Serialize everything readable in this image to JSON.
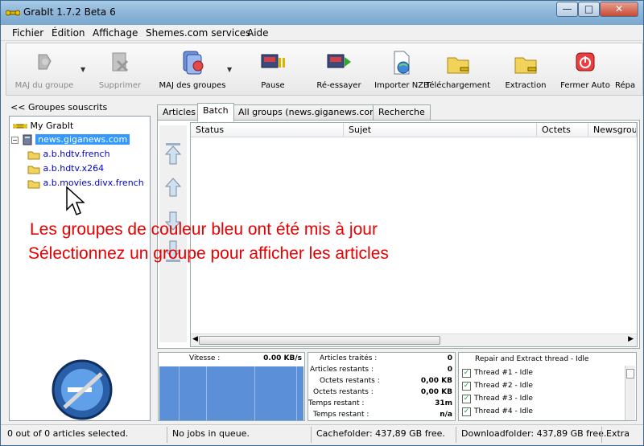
{
  "window": {
    "title": "GrabIt 1.7.2 Beta 6",
    "min": "—",
    "max": "□",
    "close": "✕"
  },
  "menu": [
    "Fichier",
    "Édition",
    "Affichage",
    "Shemes.com services",
    "Aide"
  ],
  "toolbar": [
    {
      "label": "MAJ du groupe",
      "icon": "update-group-icon",
      "enabled": false
    },
    {
      "label": "Supprimer",
      "icon": "delete-icon",
      "enabled": false
    },
    {
      "label": "MAJ des groupes",
      "icon": "update-groups-icon",
      "enabled": true
    },
    {
      "label": "Pause",
      "icon": "pause-icon",
      "enabled": true
    },
    {
      "label": "Ré-essayer",
      "icon": "retry-icon",
      "enabled": true
    },
    {
      "label": "Importer NZB",
      "icon": "import-nzb-icon",
      "enabled": true
    },
    {
      "label": "Téléchargement",
      "icon": "download-folder-icon",
      "enabled": true
    },
    {
      "label": "Extraction",
      "icon": "extraction-folder-icon",
      "enabled": true
    },
    {
      "label": "Fermer Auto",
      "icon": "auto-close-icon",
      "enabled": true
    },
    {
      "label": "Répa",
      "icon": "repair-icon",
      "enabled": true
    }
  ],
  "left_panel": {
    "collapse": "<<",
    "title": "Groupes souscrits",
    "tree": {
      "root": "My GrabIt",
      "server": "news.giganews.com",
      "groups": [
        "a.b.hdtv.french",
        "a.b.hdtv.x264",
        "a.b.movies.divx.french"
      ]
    }
  },
  "tabs": [
    "Articles",
    "Batch",
    "All groups (news.giganews.com)",
    "Recherche"
  ],
  "active_tab": "Batch",
  "columns": [
    "Status",
    "Sujet",
    "Octets",
    "Newsgroup"
  ],
  "overlay_text": {
    "line1": "Les groupes de couleur bleu ont été mis à jour",
    "line2": "Sélectionnez un groupe pour afficher les articles"
  },
  "speed": {
    "label": "Vitesse :",
    "value": "0.00 KB/s"
  },
  "stats": [
    {
      "label": "Articles traités :",
      "value": "0"
    },
    {
      "label": "Articles restants :",
      "value": "0"
    },
    {
      "label": "Octets restants :",
      "value": "0,00 KB"
    },
    {
      "label": "Octets restants :",
      "value": "0,00 KB"
    },
    {
      "label": "Temps restant :",
      "value": "31m"
    },
    {
      "label": "Temps restant :",
      "value": "n/a"
    }
  ],
  "threads": {
    "header": "Repair and Extract thread - Idle",
    "items": [
      "Thread #1 - Idle",
      "Thread #2 - Idle",
      "Thread #3 - Idle",
      "Thread #4 - Idle"
    ]
  },
  "status_bar": {
    "selection": "0 out of 0 articles selected.",
    "jobs": "No jobs in queue.",
    "cache": "Cachefolder: 437,89 GB free.",
    "download": "Downloadfolder: 437,89 GB free.",
    "extra": "Extra"
  },
  "colors": {
    "overlay": "#e80000",
    "selection": "#3399ff",
    "updated_group": "#0000cc",
    "graph": "#5b8fd8"
  }
}
